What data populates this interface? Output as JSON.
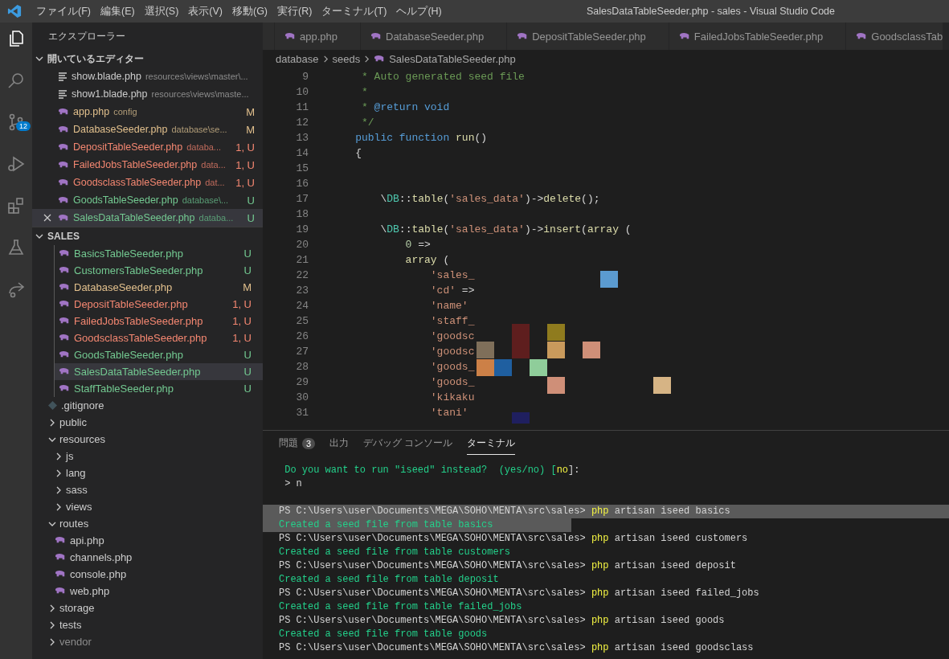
{
  "window": {
    "title": "SalesDataTableSeeder.php - sales - Visual Studio Code"
  },
  "menu": [
    "ファイル(F)",
    "編集(E)",
    "選択(S)",
    "表示(V)",
    "移動(G)",
    "実行(R)",
    "ターミナル(T)",
    "ヘルプ(H)"
  ],
  "activity_bar": [
    {
      "kind": "explorer",
      "selected": true
    },
    {
      "kind": "search",
      "selected": false
    },
    {
      "kind": "source-control",
      "selected": false,
      "badge": "12"
    },
    {
      "kind": "debug",
      "selected": false
    },
    {
      "kind": "extensions",
      "selected": false
    },
    {
      "kind": "testing",
      "selected": false
    },
    {
      "kind": "share",
      "selected": false
    }
  ],
  "sidebar": {
    "title": "エクスプローラー",
    "open_editors": {
      "title": "開いているエディター",
      "expanded": true,
      "items": [
        {
          "name": "show.blade.php",
          "path": "resources\\views\\master\\...",
          "kind": "blade",
          "modified": false,
          "untracked": false,
          "errors": false,
          "selected": false
        },
        {
          "name": "show1.blade.php",
          "path": "resources\\views\\maste...",
          "kind": "blade",
          "modified": false,
          "untracked": false,
          "errors": false,
          "selected": false
        },
        {
          "name": "app.php",
          "path": "config",
          "kind": "php",
          "modified": true,
          "untracked": false,
          "errors": false,
          "badge": "M",
          "selected": false
        },
        {
          "name": "DatabaseSeeder.php",
          "path": "database\\se...",
          "kind": "php",
          "modified": true,
          "untracked": false,
          "errors": false,
          "badge": "M",
          "selected": false
        },
        {
          "name": "DepositTableSeeder.php",
          "path": "databa...",
          "kind": "php",
          "modified": false,
          "untracked": true,
          "errors": true,
          "badge": "1, U",
          "selected": false
        },
        {
          "name": "FailedJobsTableSeeder.php",
          "path": "data...",
          "kind": "php",
          "modified": false,
          "untracked": true,
          "errors": true,
          "badge": "1, U",
          "selected": false
        },
        {
          "name": "GoodsclassTableSeeder.php",
          "path": "dat...",
          "kind": "php",
          "modified": false,
          "untracked": true,
          "errors": true,
          "badge": "1, U",
          "selected": false
        },
        {
          "name": "GoodsTableSeeder.php",
          "path": "database\\...",
          "kind": "php",
          "modified": false,
          "untracked": true,
          "errors": false,
          "badge": "U",
          "selected": false
        },
        {
          "name": "SalesDataTableSeeder.php",
          "path": "databa...",
          "kind": "php",
          "modified": false,
          "untracked": true,
          "errors": false,
          "badge": "U",
          "selected": true
        }
      ]
    },
    "project": {
      "title": "SALES",
      "expanded": true,
      "seed_files": [
        {
          "name": "BasicsTableSeeder.php",
          "modified": false,
          "untracked": true,
          "errors": false,
          "badge": "U",
          "selected": false
        },
        {
          "name": "CustomersTableSeeder.php",
          "modified": false,
          "untracked": true,
          "errors": false,
          "badge": "U",
          "selected": false
        },
        {
          "name": "DatabaseSeeder.php",
          "modified": true,
          "untracked": false,
          "errors": false,
          "badge": "M",
          "selected": false
        },
        {
          "name": "DepositTableSeeder.php",
          "modified": false,
          "untracked": true,
          "errors": true,
          "badge": "1, U",
          "selected": false
        },
        {
          "name": "FailedJobsTableSeeder.php",
          "modified": false,
          "untracked": true,
          "errors": true,
          "badge": "1, U",
          "selected": false
        },
        {
          "name": "GoodsclassTableSeeder.php",
          "modified": false,
          "untracked": true,
          "errors": true,
          "badge": "1, U",
          "selected": false
        },
        {
          "name": "GoodsTableSeeder.php",
          "modified": false,
          "untracked": true,
          "errors": false,
          "badge": "U",
          "selected": false
        },
        {
          "name": "SalesDataTableSeeder.php",
          "modified": false,
          "untracked": true,
          "errors": false,
          "badge": "U",
          "selected": true
        },
        {
          "name": "StaffTableSeeder.php",
          "modified": false,
          "untracked": true,
          "errors": false,
          "badge": "U",
          "selected": false
        }
      ],
      "tree": [
        {
          "name": ".gitignore",
          "kind": "git"
        },
        {
          "name": "public",
          "kind": "folder",
          "expanded": false
        },
        {
          "name": "resources",
          "kind": "folder",
          "expanded": true,
          "children": [
            {
              "name": "js",
              "kind": "folder",
              "expanded": false
            },
            {
              "name": "lang",
              "kind": "folder",
              "expanded": false
            },
            {
              "name": "sass",
              "kind": "folder",
              "expanded": false
            },
            {
              "name": "views",
              "kind": "folder",
              "expanded": false
            }
          ]
        },
        {
          "name": "routes",
          "kind": "folder",
          "expanded": true,
          "children": [
            {
              "name": "api.php",
              "kind": "php"
            },
            {
              "name": "channels.php",
              "kind": "php"
            },
            {
              "name": "console.php",
              "kind": "php"
            },
            {
              "name": "web.php",
              "kind": "php"
            }
          ]
        },
        {
          "name": "storage",
          "kind": "folder",
          "expanded": false
        },
        {
          "name": "tests",
          "kind": "folder",
          "expanded": false
        },
        {
          "name": "vendor",
          "kind": "folder",
          "expanded": false
        }
      ]
    }
  },
  "tabs": [
    {
      "label": "app.php",
      "selected": false
    },
    {
      "label": "DatabaseSeeder.php",
      "selected": false
    },
    {
      "label": "DepositTableSeeder.php",
      "selected": false
    },
    {
      "label": "FailedJobsTableSeeder.php",
      "selected": false
    },
    {
      "label": "GoodsclassTab",
      "selected": false
    }
  ],
  "breadcrumb": [
    "database",
    "seeds",
    "SalesDataTableSeeder.php"
  ],
  "code": [
    {
      "number": "9",
      "segments": [
        {
          "text": "     * Auto generated seed file",
          "kind": "comment"
        }
      ]
    },
    {
      "number": "10",
      "segments": [
        {
          "text": "     *",
          "kind": "comment"
        }
      ]
    },
    {
      "number": "11",
      "segments": [
        {
          "text": "     * ",
          "kind": "comment"
        },
        {
          "text": "@return void",
          "kind": "keyword"
        }
      ]
    },
    {
      "number": "12",
      "segments": [
        {
          "text": "     */",
          "kind": "comment"
        }
      ]
    },
    {
      "number": "13",
      "segments": [
        {
          "text": "    public function ",
          "kind": "keyword"
        },
        {
          "text": "run",
          "kind": "func"
        },
        {
          "text": "()",
          "kind": "plain"
        }
      ]
    },
    {
      "number": "14",
      "segments": [
        {
          "text": "    {",
          "kind": "plain"
        }
      ]
    },
    {
      "number": "15"
    },
    {
      "number": "16"
    },
    {
      "number": "17",
      "segments": [
        {
          "text": "        \\",
          "kind": "plain"
        },
        {
          "text": "DB",
          "kind": "class"
        },
        {
          "text": "::",
          "kind": "plain"
        },
        {
          "text": "table",
          "kind": "func"
        },
        {
          "text": "(",
          "kind": "plain"
        },
        {
          "text": "'sales_data'",
          "kind": "string"
        },
        {
          "text": ")->",
          "kind": "plain"
        },
        {
          "text": "delete",
          "kind": "func"
        },
        {
          "text": "();",
          "kind": "plain"
        }
      ]
    },
    {
      "number": "18"
    },
    {
      "number": "19",
      "segments": [
        {
          "text": "        \\",
          "kind": "plain"
        },
        {
          "text": "DB",
          "kind": "class"
        },
        {
          "text": "::",
          "kind": "plain"
        },
        {
          "text": "table",
          "kind": "func"
        },
        {
          "text": "(",
          "kind": "plain"
        },
        {
          "text": "'sales_data'",
          "kind": "string"
        },
        {
          "text": ")->",
          "kind": "plain"
        },
        {
          "text": "insert",
          "kind": "func"
        },
        {
          "text": "(",
          "kind": "plain"
        },
        {
          "text": "array",
          "kind": "func"
        },
        {
          "text": " (",
          "kind": "plain"
        }
      ]
    },
    {
      "number": "20",
      "segments": [
        {
          "text": "            0",
          "kind": "number"
        },
        {
          "text": " =>",
          "kind": "plain"
        }
      ]
    },
    {
      "number": "21",
      "segments": [
        {
          "text": "            array",
          "kind": "func"
        },
        {
          "text": " (",
          "kind": "plain"
        }
      ]
    },
    {
      "number": "22",
      "segments": [
        {
          "text": "                'sales_",
          "kind": "string"
        }
      ]
    },
    {
      "number": "23",
      "segments": [
        {
          "text": "                'cd'",
          "kind": "string"
        },
        {
          "text": " =>",
          "kind": "plain"
        }
      ]
    },
    {
      "number": "24",
      "segments": [
        {
          "text": "                'name'",
          "kind": "string"
        }
      ]
    },
    {
      "number": "25",
      "segments": [
        {
          "text": "                'staff_",
          "kind": "string"
        }
      ]
    },
    {
      "number": "26",
      "segments": [
        {
          "text": "                'goodsc",
          "kind": "string"
        }
      ]
    },
    {
      "number": "27",
      "segments": [
        {
          "text": "                'goodsc",
          "kind": "string"
        }
      ]
    },
    {
      "number": "28",
      "segments": [
        {
          "text": "                'goods_",
          "kind": "string"
        }
      ]
    },
    {
      "number": "29",
      "segments": [
        {
          "text": "                'goods_",
          "kind": "string"
        }
      ]
    },
    {
      "number": "30",
      "segments": [
        {
          "text": "                'kikaku",
          "kind": "string"
        }
      ]
    },
    {
      "number": "31",
      "segments": [
        {
          "text": "                'tani'",
          "kind": "string"
        }
      ]
    }
  ],
  "panel": {
    "tabs": [
      {
        "label": "問題",
        "badge": "3",
        "selected": false
      },
      {
        "label": "出力",
        "selected": false
      },
      {
        "label": "デバッグ コンソール",
        "selected": false
      },
      {
        "label": "ターミナル",
        "selected": true
      }
    ],
    "terminal": [
      {
        "selected": false,
        "segments": [
          {
            "text": " Do you want to run \"iseed\" instead?  (yes/no) [",
            "kind": "ok"
          },
          {
            "text": "no",
            "kind": "cmd"
          },
          {
            "text": "]:",
            "kind": "plain"
          }
        ]
      },
      {
        "selected": false,
        "segments": [
          {
            "text": " > n",
            "kind": "plain"
          }
        ]
      },
      {
        "selected": false
      },
      {
        "selected": true,
        "segments": [
          {
            "text": "PS C:\\Users\\user\\Documents\\MEGA\\SOHO\\MENTA\\src\\sales> ",
            "kind": "plain"
          },
          {
            "text": "php",
            "kind": "cmd"
          },
          {
            "text": " artisan iseed basics",
            "kind": "plain"
          }
        ]
      },
      {
        "selected": true,
        "segments": [
          {
            "text": "Created a seed file from table basics",
            "kind": "ok"
          }
        ]
      },
      {
        "selected": false,
        "segments": [
          {
            "text": "PS C:\\Users\\user\\Documents\\MEGA\\SOHO\\MENTA\\src\\sales> ",
            "kind": "plain"
          },
          {
            "text": "php",
            "kind": "cmd"
          },
          {
            "text": " artisan iseed customers",
            "kind": "plain"
          }
        ]
      },
      {
        "selected": false,
        "segments": [
          {
            "text": "Created a seed file from table customers",
            "kind": "ok"
          }
        ]
      },
      {
        "selected": false,
        "segments": [
          {
            "text": "PS C:\\Users\\user\\Documents\\MEGA\\SOHO\\MENTA\\src\\sales> ",
            "kind": "plain"
          },
          {
            "text": "php",
            "kind": "cmd"
          },
          {
            "text": " artisan iseed deposit",
            "kind": "plain"
          }
        ]
      },
      {
        "selected": false,
        "segments": [
          {
            "text": "Created a seed file from table deposit",
            "kind": "ok"
          }
        ]
      },
      {
        "selected": false,
        "segments": [
          {
            "text": "PS C:\\Users\\user\\Documents\\MEGA\\SOHO\\MENTA\\src\\sales> ",
            "kind": "plain"
          },
          {
            "text": "php",
            "kind": "cmd"
          },
          {
            "text": " artisan iseed failed_jobs",
            "kind": "plain"
          }
        ]
      },
      {
        "selected": false,
        "segments": [
          {
            "text": "Created a seed file from table failed_jobs",
            "kind": "ok"
          }
        ]
      },
      {
        "selected": false,
        "segments": [
          {
            "text": "PS C:\\Users\\user\\Documents\\MEGA\\SOHO\\MENTA\\src\\sales> ",
            "kind": "plain"
          },
          {
            "text": "php",
            "kind": "cmd"
          },
          {
            "text": " artisan iseed goods",
            "kind": "plain"
          }
        ]
      },
      {
        "selected": false,
        "segments": [
          {
            "text": "Created a seed file from table goods",
            "kind": "ok"
          }
        ]
      },
      {
        "selected": false,
        "segments": [
          {
            "text": "PS C:\\Users\\user\\Documents\\MEGA\\SOHO\\MENTA\\src\\sales> ",
            "kind": "plain"
          },
          {
            "text": "php",
            "kind": "cmd"
          },
          {
            "text": " artisan iseed goodsclass",
            "kind": "plain"
          }
        ]
      }
    ]
  }
}
